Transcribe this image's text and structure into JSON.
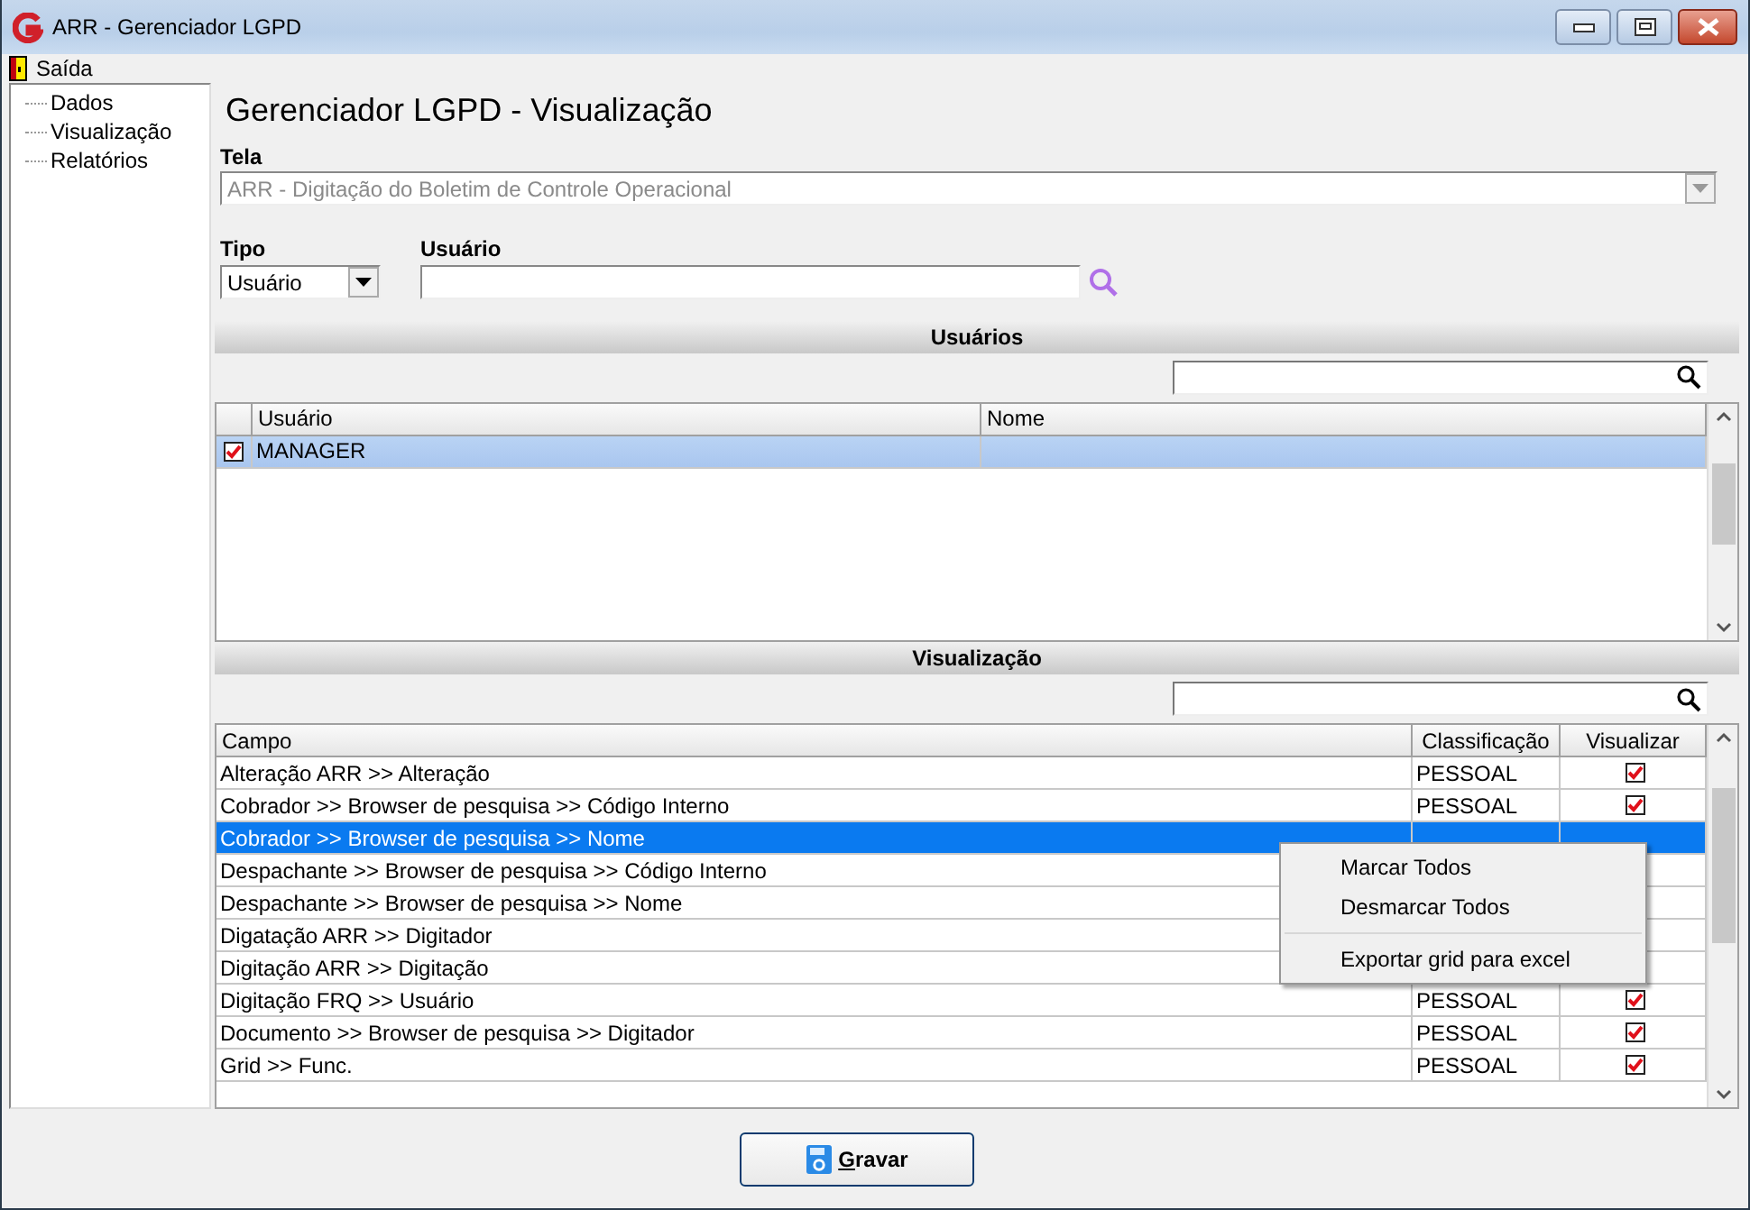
{
  "window": {
    "title": "ARR - Gerenciador LGPD"
  },
  "menu": [
    "Saída"
  ],
  "sidebar": {
    "items": [
      {
        "label": "Dados"
      },
      {
        "label": "Visualização"
      },
      {
        "label": "Relatórios"
      }
    ]
  },
  "heading": "Gerenciador LGPD - Visualização",
  "tela": {
    "label": "Tela",
    "value": "ARR - Digitação do Boletim de Controle Operacional",
    "disabled": true
  },
  "tipo": {
    "label": "Tipo",
    "value": "Usuário"
  },
  "usuario": {
    "label": "Usuário"
  },
  "usuarios": {
    "title": "Usuários",
    "columns": [
      "Usuário",
      "Nome"
    ],
    "rows": [
      {
        "usuario": "MANAGER",
        "checked": true,
        "selected": true
      }
    ]
  },
  "visualizacao": {
    "title": "Visualização",
    "columns": [
      "Campo",
      "Classificação",
      "Visualizar"
    ],
    "rows": [
      {
        "campo": "Alteração ARR >> Alteração",
        "classificacao": "PESSOAL",
        "visualizar": true,
        "selected": false
      },
      {
        "campo": "Cobrador >> Browser de pesquisa >> Código Interno",
        "classificacao": "PESSOAL",
        "visualizar": true,
        "selected": false
      },
      {
        "campo": "Cobrador >> Browser de pesquisa >> Nome",
        "selected": true
      },
      {
        "campo": "Despachante >> Browser de pesquisa >> Código Interno",
        "selected": false
      },
      {
        "campo": "Despachante >> Browser de pesquisa >> Nome",
        "selected": false
      },
      {
        "campo": "Digatação ARR >> Digitador",
        "selected": false
      },
      {
        "campo": "Digitação ARR >> Digitação",
        "selected": false
      },
      {
        "campo": "Digitação FRQ >> Usuário",
        "classificacao": "PESSOAL",
        "visualizar": true,
        "selected": false
      },
      {
        "campo": "Documento >> Browser de pesquisa >> Digitador",
        "classificacao": "PESSOAL",
        "visualizar": true,
        "selected": false
      },
      {
        "campo": "Grid >> Func.",
        "classificacao": "PESSOAL",
        "visualizar": true,
        "selected": false
      }
    ]
  },
  "context_menu": [
    {
      "label": "Marcar Todos",
      "kind": "item"
    },
    {
      "label": "Desmarcar Todos",
      "kind": "item"
    },
    {
      "kind": "separator"
    },
    {
      "label": "Exportar grid para excel",
      "kind": "item"
    }
  ],
  "save_button": "Gravar"
}
